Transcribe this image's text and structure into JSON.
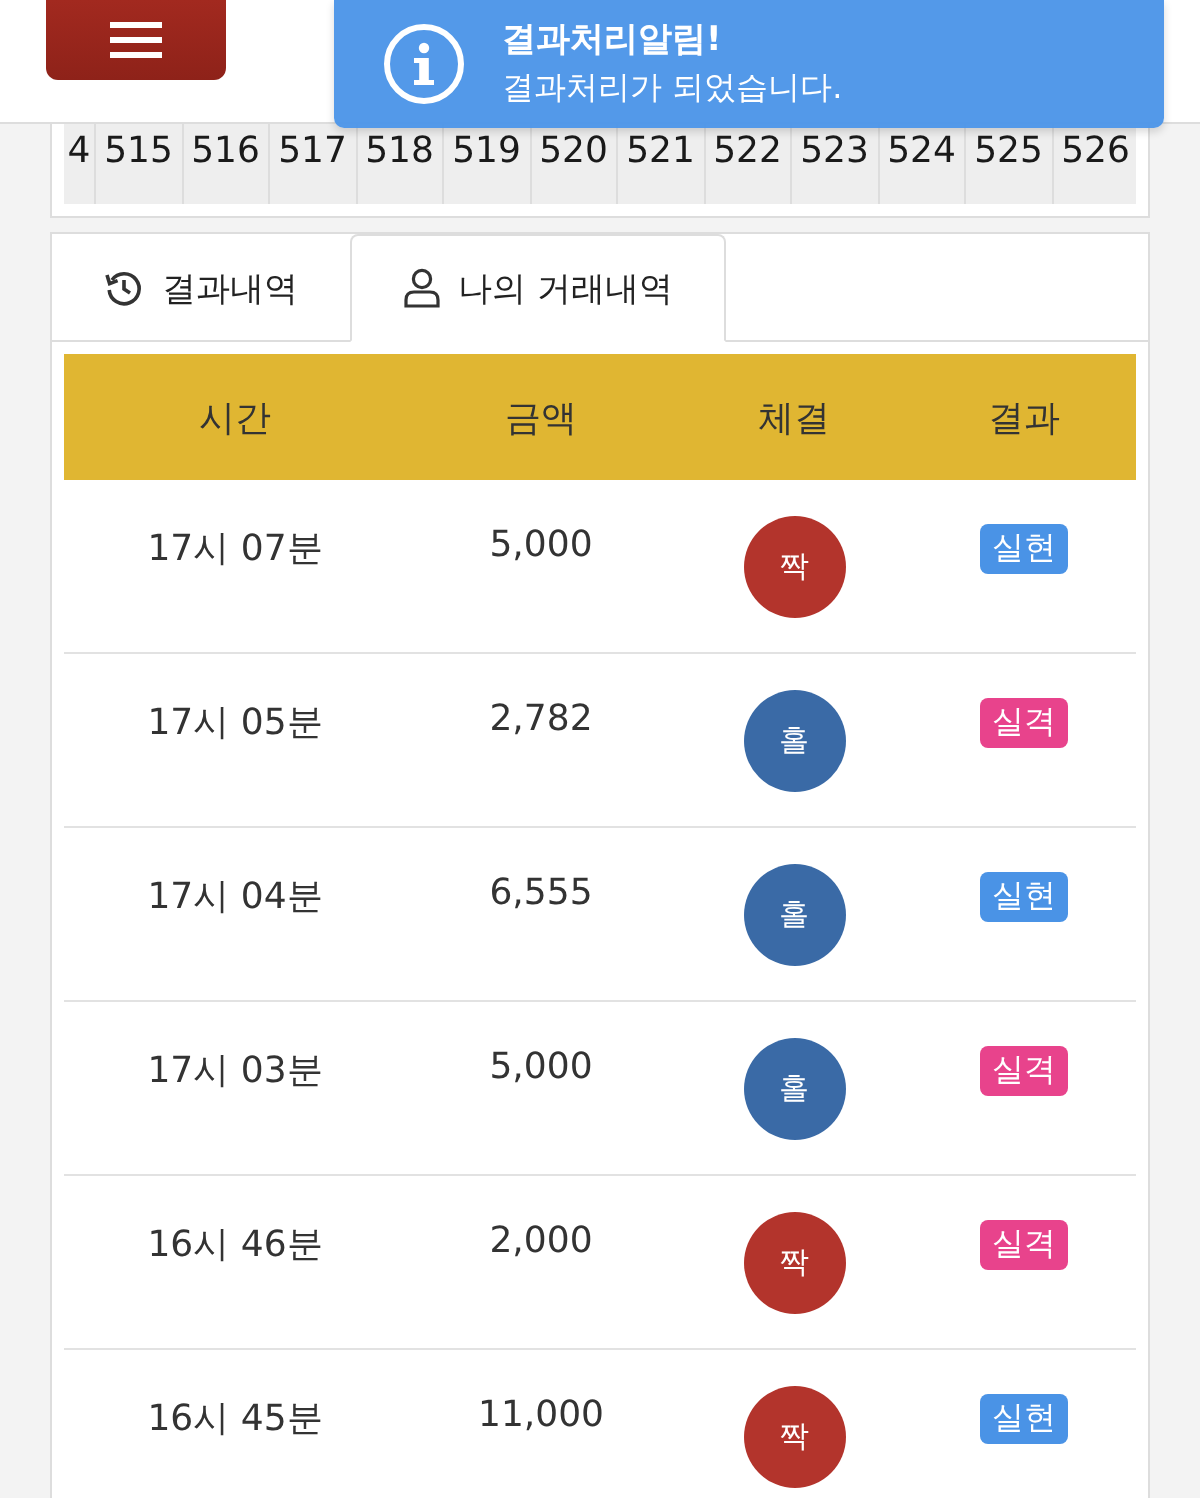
{
  "toast": {
    "title": "결과처리알림!",
    "message": "결과처리가 되었습니다."
  },
  "rounds": [
    "4",
    "515",
    "516",
    "517",
    "518",
    "519",
    "520",
    "521",
    "522",
    "523",
    "524",
    "525",
    "526"
  ],
  "tabs": [
    {
      "label": "결과내역",
      "selected": false,
      "kind": "history"
    },
    {
      "label": "나의 거래내역",
      "selected": true,
      "kind": "user"
    }
  ],
  "table": {
    "columns": [
      "시간",
      "금액",
      "체결",
      "결과"
    ],
    "rows": [
      {
        "time": "17시 07분",
        "amount": "5,000",
        "pick": {
          "label": "짝",
          "color": "#b3342c"
        },
        "result": {
          "label": "실현",
          "color": "#4a93e6"
        }
      },
      {
        "time": "17시 05분",
        "amount": "2,782",
        "pick": {
          "label": "홀",
          "color": "#3a6aa6"
        },
        "result": {
          "label": "실격",
          "color": "#e8438c"
        }
      },
      {
        "time": "17시 04분",
        "amount": "6,555",
        "pick": {
          "label": "홀",
          "color": "#3a6aa6"
        },
        "result": {
          "label": "실현",
          "color": "#4a93e6"
        }
      },
      {
        "time": "17시 03분",
        "amount": "5,000",
        "pick": {
          "label": "홀",
          "color": "#3a6aa6"
        },
        "result": {
          "label": "실격",
          "color": "#e8438c"
        }
      },
      {
        "time": "16시 46분",
        "amount": "2,000",
        "pick": {
          "label": "짝",
          "color": "#b3342c"
        },
        "result": {
          "label": "실격",
          "color": "#e8438c"
        }
      },
      {
        "time": "16시 45분",
        "amount": "11,000",
        "pick": {
          "label": "짝",
          "color": "#b3342c"
        },
        "result": {
          "label": "실현",
          "color": "#4a93e6"
        }
      }
    ]
  }
}
